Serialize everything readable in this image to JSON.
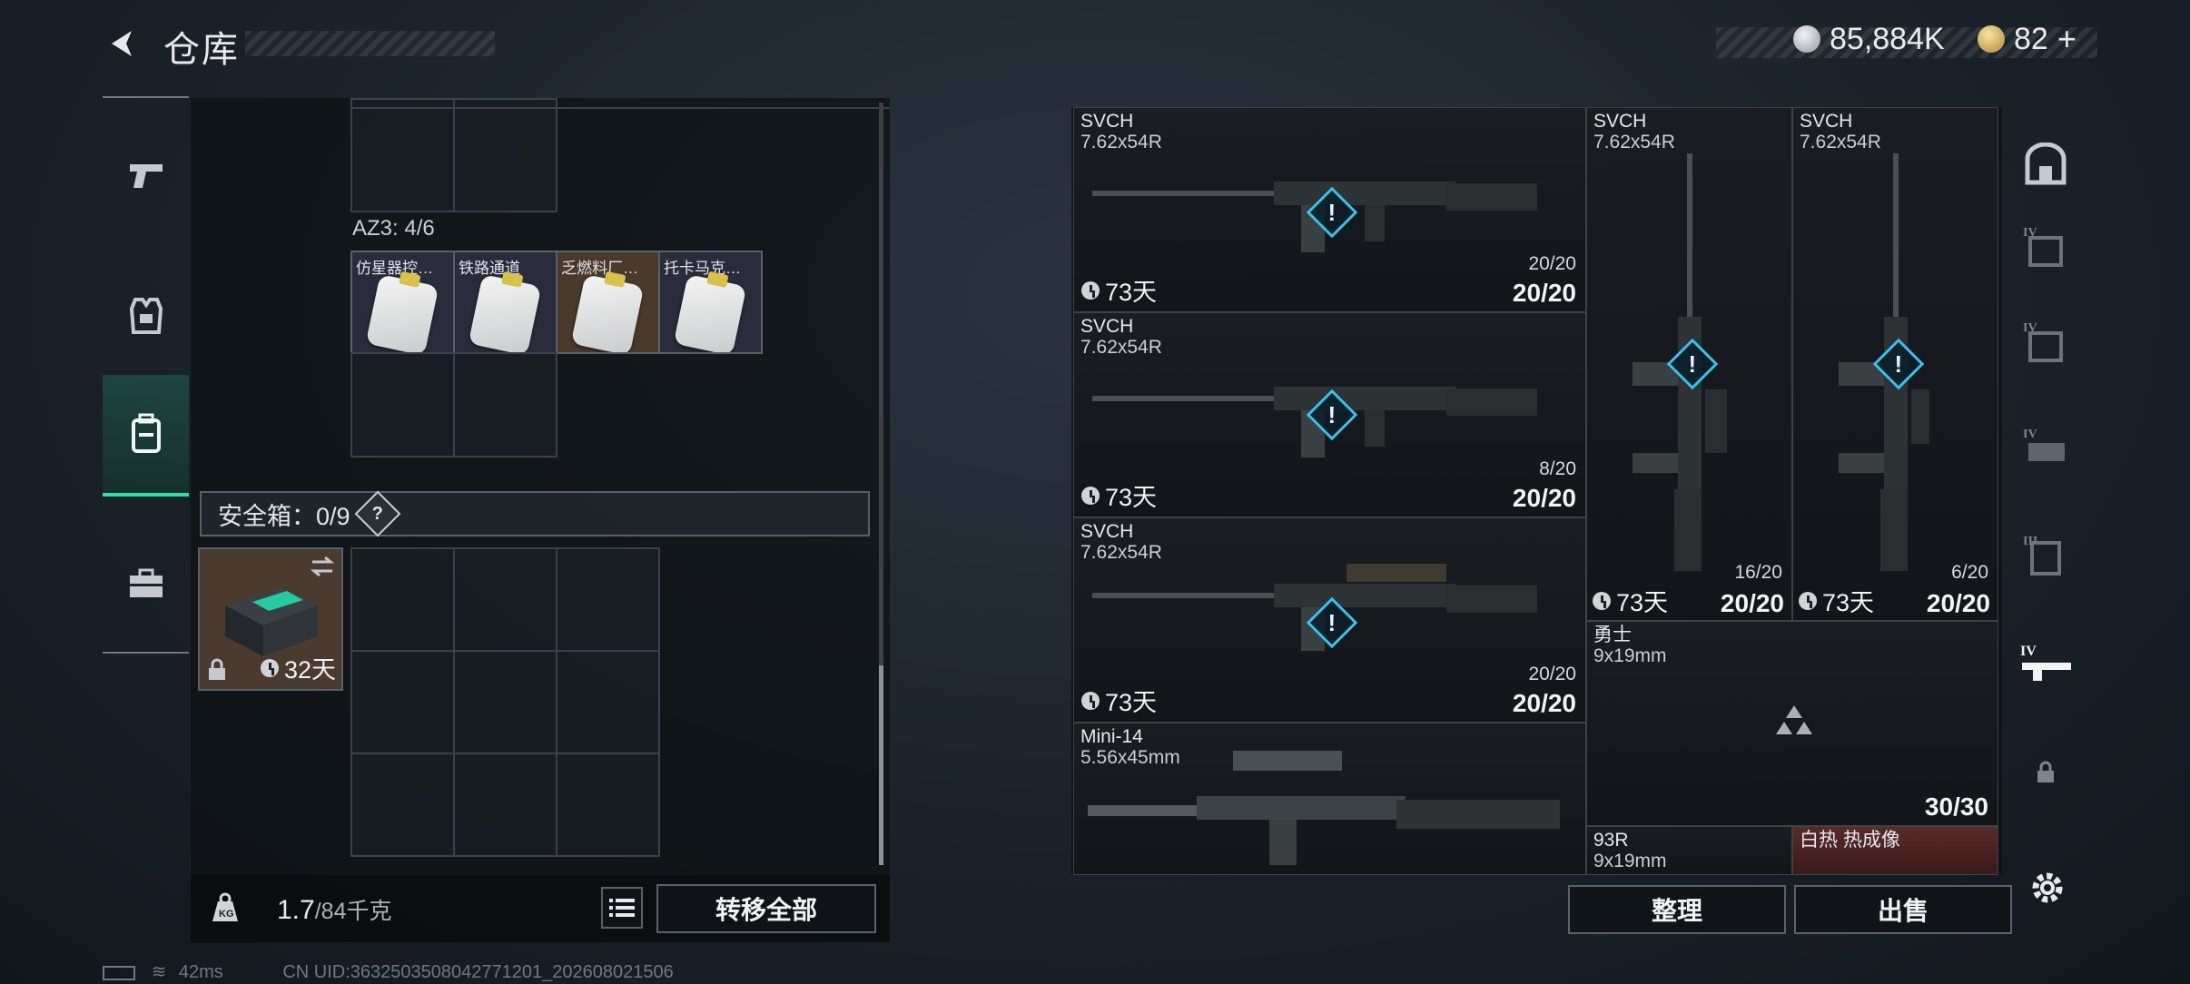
{
  "header": {
    "title": "仓库",
    "silver": "85,884K",
    "gold": "82",
    "gold_plus": "+"
  },
  "left_nav": {
    "items": [
      {
        "id": "weapon",
        "icon": "pistol-icon"
      },
      {
        "id": "armor",
        "icon": "armor-vest-icon"
      },
      {
        "id": "backpack",
        "icon": "backpack-icon",
        "active": true
      },
      {
        "id": "case",
        "icon": "toolbox-icon"
      }
    ]
  },
  "inventory": {
    "az3_label": "AZ3: 4/6",
    "keys": [
      {
        "label": "仿星器控…"
      },
      {
        "label": "铁路通道"
      },
      {
        "label": "乏燃料厂…"
      },
      {
        "label": "托卡马克…"
      }
    ],
    "safebox_label": "安全箱：0/9",
    "safebox_help": "?",
    "safebox_item_days": "32天",
    "weight": "1.7",
    "weight_total": "/84千克",
    "transfer_all": "转移全部"
  },
  "stash": {
    "weapons": [
      {
        "name": "SVCH",
        "caliber": "7.62x54R",
        "mag": "20/20",
        "ammo": "20/20",
        "days": "73天"
      },
      {
        "name": "SVCH",
        "caliber": "7.62x54R",
        "mag": "8/20",
        "ammo": "20/20",
        "days": "73天"
      },
      {
        "name": "SVCH",
        "caliber": "7.62x54R",
        "mag": "20/20",
        "ammo": "20/20",
        "days": "73天"
      },
      {
        "name": "SVCH",
        "caliber": "7.62x54R",
        "mag": "16/20",
        "ammo": "20/20",
        "days": "73天"
      },
      {
        "name": "SVCH",
        "caliber": "7.62x54R",
        "mag": "6/20",
        "ammo": "20/20",
        "days": "73天"
      },
      {
        "name": "勇士",
        "caliber": "9x19mm",
        "ammo": "30/30"
      },
      {
        "name": "Mini-14",
        "caliber": "5.56x45mm"
      },
      {
        "name": "93R",
        "caliber": "9x19mm"
      },
      {
        "name": "白热 热成像",
        "caliber": ""
      }
    ],
    "organize": "整理",
    "sell": "出售"
  },
  "right_nav": {
    "items": [
      {
        "icon": "all-items-icon"
      },
      {
        "icon": "tier4-armor-icon",
        "tier": "IV"
      },
      {
        "icon": "tier4-armor-icon",
        "tier": "IV"
      },
      {
        "icon": "tier4-rig-icon",
        "tier": "IV"
      },
      {
        "icon": "tier3-bag-icon",
        "tier": "III"
      },
      {
        "icon": "tier4-weapon-icon",
        "tier": "IV",
        "active": true
      },
      {
        "icon": "lock-icon"
      },
      {
        "icon": "gear-icon"
      }
    ]
  },
  "footer": {
    "ping": "42ms",
    "uid": "CN UID:3632503508042771201_202608021506"
  }
}
